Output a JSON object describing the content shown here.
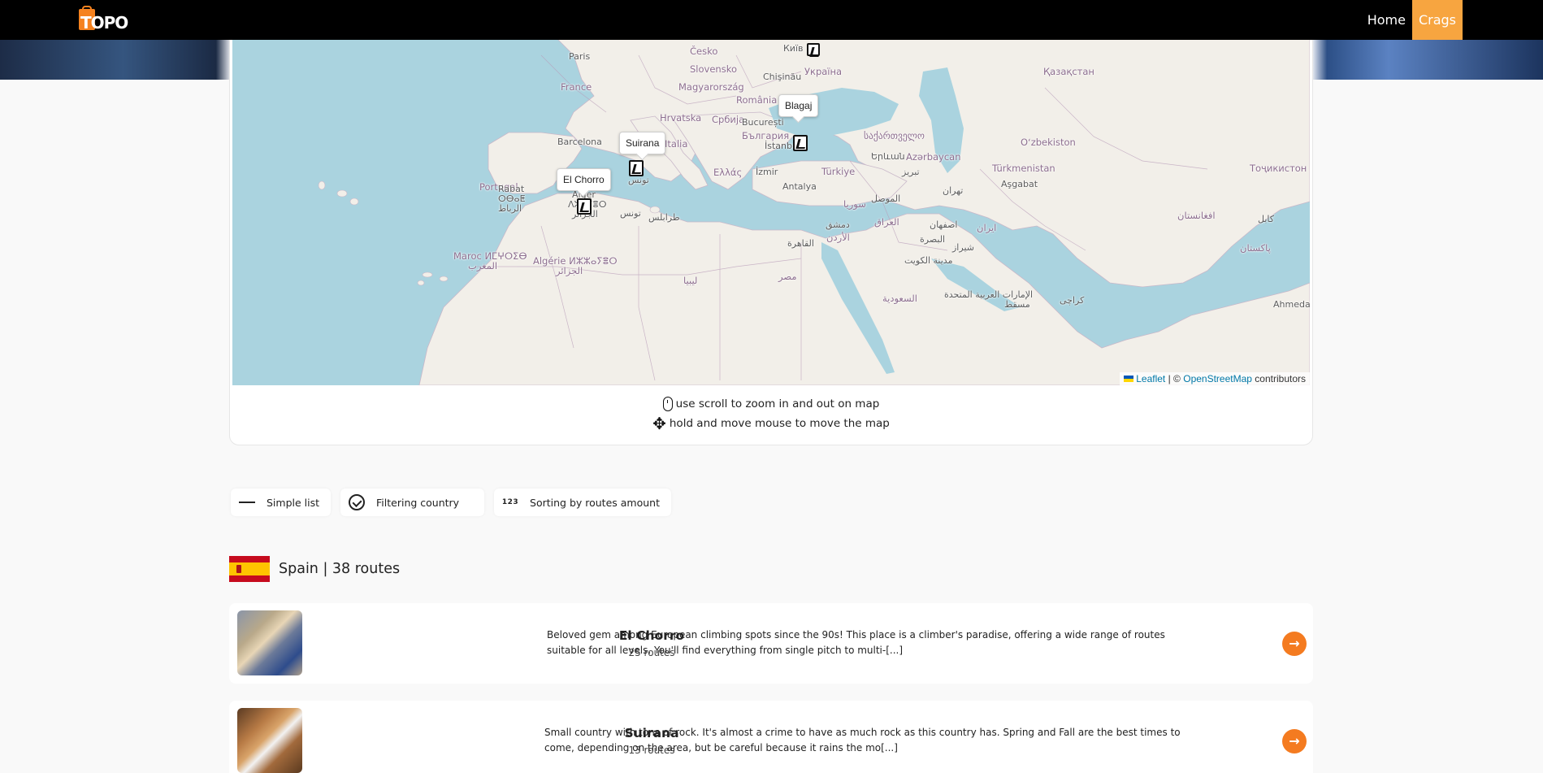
{
  "header": {
    "logo_text": "TOPO",
    "nav": [
      {
        "label": "Home",
        "active": false
      },
      {
        "label": "Crags",
        "active": true
      }
    ],
    "accent_color": "#f7a540"
  },
  "map": {
    "labels": {
      "paris": "Paris",
      "france": "France",
      "cesko": "Česko",
      "slovensko": "Slovensko",
      "kyiv": "Київ",
      "chisinau": "Chişinău",
      "ukraine": "Україна",
      "magyarorszag": "Magyarország",
      "romania": "România",
      "hrvatska": "Hrvatska",
      "srbija": "Србија",
      "bucuresti": "București",
      "bulgaria": "България",
      "barcelona": "Barcelona",
      "portugal": "Portugal",
      "italia": "Italia",
      "istanbul": "İstanbul",
      "ellas": "Ελλάς",
      "izmir": "İzmir",
      "ankara": "Antalya",
      "turkiye": "Türkiye",
      "georgia": "საქართველო",
      "yerevan": "Երևան",
      "azerbaycan": "Azərbaycan",
      "tabriz": "تبریز",
      "kazakhstan": "Қазақстан",
      "uzbekiston": "Oʻzbekiston",
      "turkmenistan": "Türkmenistan",
      "asgabat": "Aşgabat",
      "tajik": "Тоҷикистон",
      "tehran": "تهران",
      "afghan": "افغانستان",
      "kabul": "کابل",
      "pakistan": "پاکستان",
      "rabat": "Rabat",
      "rabat_tif": "ⵔⴱⴰⵟ",
      "rabat_ar": "الرباط",
      "alger": "Alger",
      "alger_tif": "ⴷⵣⴰⵢⴻⵔ",
      "alger_ar": "الجزائر",
      "tunis": "تونس",
      "tunis2": "تونس",
      "tripoli": "طرابلس",
      "maroc": "Maroc ⵍⵎⵖⵔⵉⴱ",
      "maghrib": "المغرب",
      "algerie": "Algérie ⵍⵣⵣⴰⵢⴻⵔ",
      "jazair": "الجزائر",
      "libya": "ليبيا",
      "cairo": "القاهرة",
      "misr": "مصر",
      "syria": "سوريا",
      "dimashq": "دمشق",
      "urdun": "الأردن",
      "iraq": "العراق",
      "mosul": "الموصل",
      "basra": "البصرة",
      "kuwait": "مدينة الكويت",
      "isfahan": "اصفهان",
      "iran": "ایران",
      "shiraz": "شیراز",
      "saudi": "السعودية",
      "uae": "الإمارات العربية المتحدة",
      "muscat": "مسقط",
      "karachi": "کراچی",
      "ahmedabad": "Ahmeda"
    },
    "markers": [
      {
        "name": "El Chorro"
      },
      {
        "name": "Suirana"
      },
      {
        "name": "Blagaj"
      }
    ],
    "attribution": {
      "leaflet": "Leaflet",
      "sep": "| ©",
      "osm": "OpenStreetMap",
      "suffix": "contributors"
    }
  },
  "hints": {
    "scroll": "use scroll to zoom in and out on map",
    "move": "hold and move mouse to move the map"
  },
  "filters": [
    {
      "label": "Simple list",
      "icon": "list-lines-icon"
    },
    {
      "label": "Filtering country",
      "icon": "check-circle-icon"
    },
    {
      "label": "Sorting by routes amount",
      "icon": "number-sort-icon",
      "icon_text": "123"
    }
  ],
  "country_group": {
    "title": "Spain | 38 routes",
    "flag": "spain-flag"
  },
  "crags": [
    {
      "name": "El Chorro",
      "routes": "25 routes",
      "description": "Beloved gem among European climbing spots since the 90s! This place is a climber's paradise, offering a wide range of routes suitable for all levels. You'll find everything from single pitch to multi-[...]"
    },
    {
      "name": "Suirana",
      "routes": "13 routes",
      "description": "Small country with tons of rock. It's almost a crime to have as much rock as this country has. Spring and Fall are the best times to come, depending on the area, but be careful because it rains the mo[...]"
    }
  ]
}
